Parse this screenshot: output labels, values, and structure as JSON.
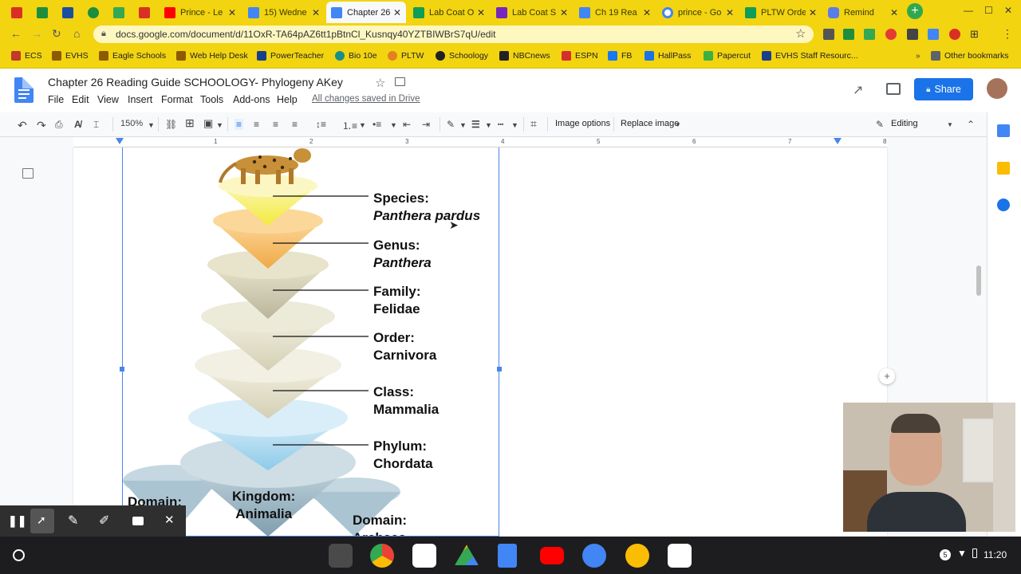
{
  "browser": {
    "tabs": [
      {
        "label": "",
        "color": "#d93025"
      },
      {
        "label": "",
        "color": "#1e8e3e"
      },
      {
        "label": "",
        "color": "#1a4fa0"
      },
      {
        "label": "",
        "color": "#1e8e3e"
      },
      {
        "label": "",
        "color": "#34a853"
      },
      {
        "label": "",
        "color": "#d93025"
      },
      {
        "label": "Prince - Le",
        "color": "#ff0000"
      },
      {
        "label": "15) Wedne",
        "color": "#4285f4"
      },
      {
        "label": "Chapter 26",
        "color": "#4285f4"
      },
      {
        "label": "Lab Coat O",
        "color": "#0f9d58"
      },
      {
        "label": "Lab Coat S",
        "color": "#7627bb"
      },
      {
        "label": "Ch 19 Rea",
        "color": "#4285f4"
      },
      {
        "label": "prince - Go",
        "color": "#4285f4"
      },
      {
        "label": "PLTW Orde",
        "color": "#0f9d58"
      },
      {
        "label": "Remind",
        "color": "#5a7ce8"
      }
    ],
    "new_tab": "+",
    "url": "docs.google.com/document/d/11OxR-TA64pAZ6tt1pBtnCl_Kusnqy40YZTBIWBrS7qU/edit",
    "bookmarks": [
      {
        "label": "ECS",
        "color": "#c0392b"
      },
      {
        "label": "EVHS",
        "color": "#8e5a00"
      },
      {
        "label": "Eagle Schools",
        "color": "#8e5a00"
      },
      {
        "label": "Web Help Desk",
        "color": "#8e5a00"
      },
      {
        "label": "PowerTeacher",
        "color": "#1a3f8a"
      },
      {
        "label": "Bio 10e",
        "color": "#1a8f8a"
      },
      {
        "label": "PLTW",
        "color": "#e67e22"
      },
      {
        "label": "Schoology",
        "color": "#202124"
      },
      {
        "label": "NBCnews",
        "color": "#202124"
      },
      {
        "label": "ESPN",
        "color": "#d32f2f"
      },
      {
        "label": "FB",
        "color": "#1877f2"
      },
      {
        "label": "HallPass",
        "color": "#1a73e8"
      },
      {
        "label": "Papercut",
        "color": "#3cb043"
      },
      {
        "label": "EVHS Staff Resourc...",
        "color": "#1a3f8a"
      }
    ],
    "other_bookmarks": "Other bookmarks"
  },
  "docs": {
    "title": "Chapter 26 Reading Guide SCHOOLOGY- Phylogeny AKey",
    "menu": [
      "File",
      "Edit",
      "View",
      "Insert",
      "Format",
      "Tools",
      "Add-ons",
      "Help"
    ],
    "saved_status": "All changes saved in Drive",
    "share_label": "Share",
    "zoom": "150%",
    "image_options": "Image options",
    "replace_image": "Replace image",
    "mode": "Editing",
    "ruler_numbers": [
      "1",
      "2",
      "3",
      "4",
      "5",
      "6",
      "7",
      "8"
    ]
  },
  "figure": {
    "ranks": [
      {
        "rank": "Species:",
        "name": "Panthera pardus",
        "italic": true
      },
      {
        "rank": "Genus:",
        "name": "Panthera",
        "italic": true
      },
      {
        "rank": "Family:",
        "name": "Felidae",
        "italic": false
      },
      {
        "rank": "Order:",
        "name": "Carnivora",
        "italic": false
      },
      {
        "rank": "Class:",
        "name": "Mammalia",
        "italic": false
      },
      {
        "rank": "Phylum:",
        "name": "Chordata",
        "italic": false
      }
    ],
    "domain_left": "Domain:",
    "kingdom": "Kingdom:",
    "kingdom_name": "Animalia",
    "domain_right": "Domain:",
    "domain_right_name": "Archaea"
  },
  "shelf": {
    "clock": "11:20",
    "badge": "5"
  }
}
